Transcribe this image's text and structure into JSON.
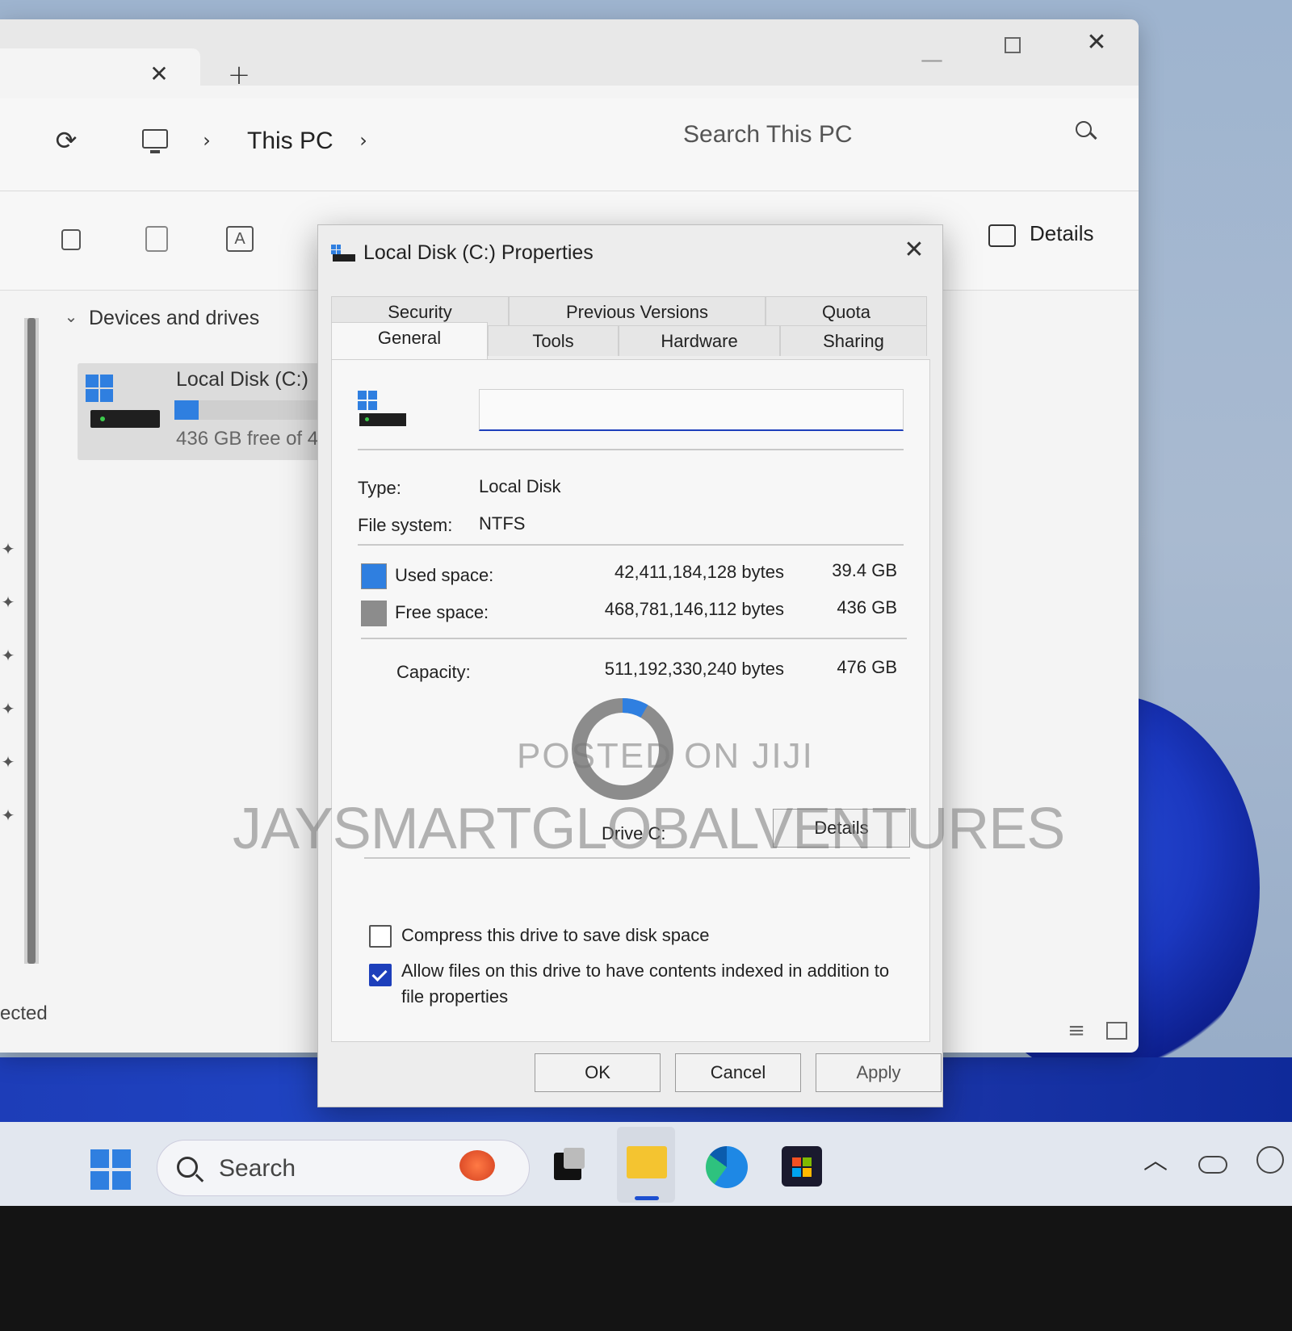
{
  "explorer": {
    "tab_close_icon": "close-icon",
    "new_tab_icon": "plus-icon",
    "window_controls": [
      "minimize-icon",
      "maximize-icon",
      "close-icon"
    ],
    "breadcrumb": {
      "location": "This PC"
    },
    "search": {
      "placeholder": "Search This PC"
    },
    "toolbar": {
      "details_label": "Details"
    },
    "nav": {
      "section_label": "Devices and drives",
      "drive_name": "Local Disk (C:)",
      "drive_free": "436 GB free of 4"
    },
    "status_fragment": "ected"
  },
  "dialog": {
    "title": "Local Disk (C:) Properties",
    "tabs_row1": [
      "Security",
      "Previous Versions",
      "Quota"
    ],
    "tabs_row2": [
      "General",
      "Tools",
      "Hardware",
      "Sharing"
    ],
    "active_tab": "General",
    "name_value": "",
    "type_label": "Type:",
    "type_value": "Local Disk",
    "fs_label": "File system:",
    "fs_value": "NTFS",
    "used_label": "Used space:",
    "used_bytes": "42,411,184,128 bytes",
    "used_size": "39.4 GB",
    "free_label": "Free space:",
    "free_bytes": "468,781,146,112 bytes",
    "free_size": "436 GB",
    "capacity_label": "Capacity:",
    "capacity_bytes": "511,192,330,240 bytes",
    "capacity_size": "476 GB",
    "used_fraction": 0.083,
    "drive_label": "Drive C:",
    "details_button": "Details",
    "compress_label": "Compress this drive to save disk space",
    "compress_checked": false,
    "index_label_line1": "Allow files on this drive to have contents indexed in addition to",
    "index_label_line2": "file properties",
    "index_checked": true,
    "ok_button": "OK",
    "cancel_button": "Cancel",
    "apply_button": "Apply",
    "colors": {
      "used": "#2f7fe0",
      "free": "#8c8c8c",
      "accent": "#1d3fbb"
    }
  },
  "watermark": {
    "line1": "POSTED ON JIJI",
    "line2": "JAYSMARTGLOBALVENTURES"
  },
  "taskbar": {
    "search_label": "Search",
    "apps": [
      "start-icon",
      "task-view-icon",
      "file-explorer-icon",
      "edge-icon",
      "store-icon"
    ],
    "tray": [
      "chevron-up-icon",
      "onedrive-icon",
      "network-icon"
    ]
  }
}
